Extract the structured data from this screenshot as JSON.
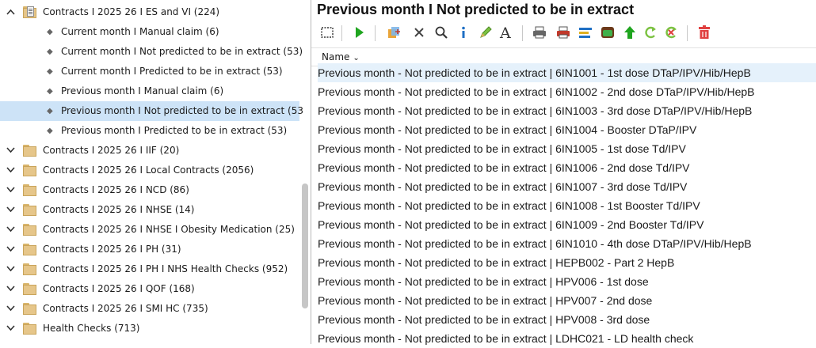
{
  "tree": {
    "parent_expanded": {
      "label": "Contracts I 2025 26 I ES and VI (224)"
    },
    "children": [
      {
        "label": "Current month I Manual claim (6)",
        "selected": false
      },
      {
        "label": "Current month I Not predicted to be in extract (53)",
        "selected": false
      },
      {
        "label": "Current month I Predicted to be in extract (53)",
        "selected": false
      },
      {
        "label": "Previous month I Manual claim (6)",
        "selected": false
      },
      {
        "label": "Previous month I Not predicted to be in extract (53",
        "selected": true
      },
      {
        "label": "Previous month I Predicted to be in extract (53)",
        "selected": false
      }
    ],
    "folders": [
      {
        "label": "Contracts I 2025 26 I IIF (20)"
      },
      {
        "label": "Contracts I 2025 26 I Local Contracts (2056)"
      },
      {
        "label": "Contracts I 2025 26 I NCD (86)"
      },
      {
        "label": "Contracts I 2025 26 I NHSE (14)"
      },
      {
        "label": "Contracts I 2025 26 I NHSE I Obesity Medication (25)"
      },
      {
        "label": "Contracts I 2025 26 I PH (31)"
      },
      {
        "label": "Contracts I 2025 26 I PH I NHS Health Checks (952)"
      },
      {
        "label": "Contracts I 2025 26 I QOF (168)"
      },
      {
        "label": "Contracts I 2025 26 I SMI HC (735)"
      },
      {
        "label": "Health Checks (713)"
      }
    ]
  },
  "main": {
    "title": "Previous month I Not predicted to be in extract",
    "column_header": "Name",
    "rows": [
      "Previous month - Not predicted to be in extract | 6IN1001 - 1st dose DTaP/IPV/Hib/HepB",
      "Previous month - Not predicted to be in extract | 6IN1002 - 2nd dose DTaP/IPV/Hib/HepB",
      "Previous month - Not predicted to be in extract | 6IN1003 - 3rd dose DTaP/IPV/Hib/HepB",
      "Previous month - Not predicted to be in extract | 6IN1004 - Booster DTaP/IPV",
      "Previous month - Not predicted to be in extract | 6IN1005 - 1st dose Td/IPV",
      "Previous month - Not predicted to be in extract | 6IN1006 - 2nd dose Td/IPV",
      "Previous month - Not predicted to be in extract | 6IN1007 - 3rd dose Td/IPV",
      "Previous month - Not predicted to be in extract | 6IN1008 - 1st Booster Td/IPV",
      "Previous month - Not predicted to be in extract | 6IN1009 - 2nd Booster Td/IPV",
      "Previous month - Not predicted to be in extract | 6IN1010 - 4th dose DTaP/IPV/Hib/HepB",
      "Previous month - Not predicted to be in extract | HEPB002 - Part 2 HepB",
      "Previous month - Not predicted to be in extract | HPV006 - 1st dose",
      "Previous month - Not predicted to be in extract | HPV007 - 2nd dose",
      "Previous month - Not predicted to be in extract | HPV008 - 3rd dose",
      "Previous month - Not predicted to be in extract | LDHC021 - LD health check"
    ]
  },
  "toolbar": {
    "icons": [
      "select-icon",
      "run-icon",
      "add-rule-icon",
      "delete-icon",
      "search-icon",
      "info-icon",
      "edit-icon",
      "font-icon",
      "print-icon",
      "print-report-icon",
      "export-icon",
      "report-icon",
      "move-up-icon",
      "refresh-icon",
      "refresh-red-icon",
      "trash-icon"
    ]
  },
  "colors": {
    "selected_row": "#cde3f7",
    "highlight_row": "#e5f1fb",
    "folder": "#e6c68a",
    "accent_green": "#1fa51f",
    "delete_red": "#e04040"
  }
}
